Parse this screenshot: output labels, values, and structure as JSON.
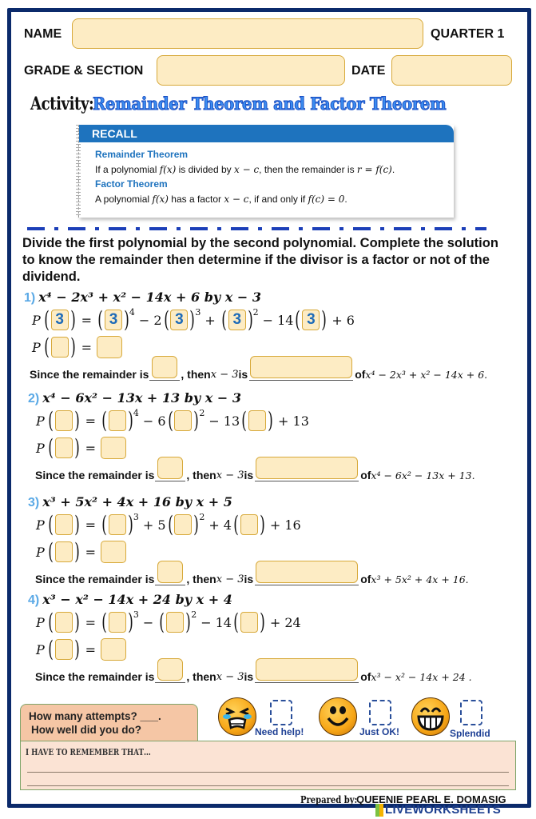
{
  "header": {
    "name_label": "NAME",
    "quarter_label": "QUARTER 1",
    "grade_section_label": "GRADE & SECTION",
    "date_label": "DATE",
    "name_value": "",
    "grade_section_value": "",
    "date_value": ""
  },
  "activity": {
    "prefix": "Activity:",
    "title": "Remainder Theorem and Factor Theorem"
  },
  "recall": {
    "heading": "RECALL",
    "remainder_title": "Remainder Theorem",
    "remainder_text_1": "If a polynomial ",
    "remainder_fx": "f(x)",
    "remainder_text_2": " is divided by ",
    "remainder_xc": "x − c",
    "remainder_text_3": ", then the remainder is ",
    "remainder_r": "r = f(c)",
    "remainder_end": ".",
    "factor_title": "Factor Theorem",
    "factor_text_1": "A polynomial ",
    "factor_fx": "f(x)",
    "factor_text_2": " has a factor ",
    "factor_xc": "x − c",
    "factor_text_3": ", if and only if ",
    "factor_cond": "f(c) = 0",
    "factor_end": "."
  },
  "instructions": "Divide the first polynomial by the second polynomial. Complete the solution to know the remainder then determine if the divisor is a factor or not of the dividend.",
  "problems": [
    {
      "number": "1)",
      "polynomial": "x⁴ − 2x³ + x² − 14x + 6 by x − 3",
      "terms": [
        {
          "op": "",
          "coef": "",
          "exp": "4"
        },
        {
          "op": "−",
          "coef": "2",
          "exp": "3"
        },
        {
          "op": "+",
          "coef": "",
          "exp": "2"
        },
        {
          "op": "−",
          "coef": "14",
          "exp": ""
        }
      ],
      "constant": "+ 6",
      "prefilled_value": "3",
      "remainder_answer": "",
      "factor_answer": "",
      "since_text_1": "Since the remainder is ",
      "since_text_2": ", then ",
      "divisor": "x − 3",
      "since_text_3": " is ",
      "since_text_4": " of ",
      "dividend": "x⁴ − 2x³ + x² − 14x + 6."
    },
    {
      "number": "2)",
      "polynomial": "x⁴ − 6x² − 13x + 13 by x − 3",
      "terms": [
        {
          "op": "",
          "coef": "",
          "exp": "4"
        },
        {
          "op": "−",
          "coef": "6",
          "exp": "2"
        },
        {
          "op": "−",
          "coef": "13",
          "exp": ""
        }
      ],
      "constant": "+ 13",
      "prefilled_value": "",
      "remainder_answer": "",
      "factor_answer": "",
      "since_text_1": "Since the remainder is ",
      "since_text_2": ", then ",
      "divisor": "x − 3",
      "since_text_3": " is ",
      "since_text_4": " of ",
      "dividend": "x⁴ − 6x² − 13x + 13."
    },
    {
      "number": "3)",
      "polynomial": "x³ + 5x² + 4x + 16 by x + 5",
      "terms": [
        {
          "op": "",
          "coef": "",
          "exp": "3"
        },
        {
          "op": "+",
          "coef": "5",
          "exp": "2"
        },
        {
          "op": "+",
          "coef": "4",
          "exp": ""
        }
      ],
      "constant": "+ 16",
      "prefilled_value": "",
      "remainder_answer": "",
      "factor_answer": "",
      "since_text_1": "Since the remainder is ",
      "since_text_2": ", then ",
      "divisor": "x − 3",
      "since_text_3": " is ",
      "since_text_4": " of ",
      "dividend": "x³ + 5x² + 4x + 16."
    },
    {
      "number": "4)",
      "polynomial": "x³ − x² − 14x + 24 by x + 4",
      "terms": [
        {
          "op": "",
          "coef": "",
          "exp": "3"
        },
        {
          "op": "−",
          "coef": "",
          "exp": "2"
        },
        {
          "op": "−",
          "coef": "14",
          "exp": ""
        }
      ],
      "constant": "+ 24",
      "prefilled_value": "",
      "remainder_answer": "",
      "factor_answer": "",
      "since_text_1": "Since the remainder is ",
      "since_text_2": ", then ",
      "divisor": "x − 3",
      "since_text_3": " is ",
      "since_text_4": " of ",
      "dividend": "x³ − x² − 14x + 24 ."
    }
  ],
  "self_assessment": {
    "attempts_text": "How many attempts? ___.",
    "how_well_text": "How well did you do?",
    "options": [
      {
        "icon": "crying-face-icon",
        "label": "Need help!"
      },
      {
        "icon": "smiling-face-icon",
        "label": "Just OK!"
      },
      {
        "icon": "grinning-face-icon",
        "label": "Splendid"
      }
    ],
    "remember_label": "I HAVE TO REMEMBER THAT…"
  },
  "footer": {
    "prepared_by_label": "Prepared by:",
    "author": "QUEENIE PEARL E. DOMASIG",
    "watermark": "LIVEWORKSHEETS"
  },
  "colors": {
    "frame": "#0b2a6b",
    "field_fill": "#fdecc4",
    "field_border": "#d7a93a",
    "title_blue": "#3b8df0",
    "recall_blue": "#1e73be",
    "question_number": "#5aa9e6"
  }
}
